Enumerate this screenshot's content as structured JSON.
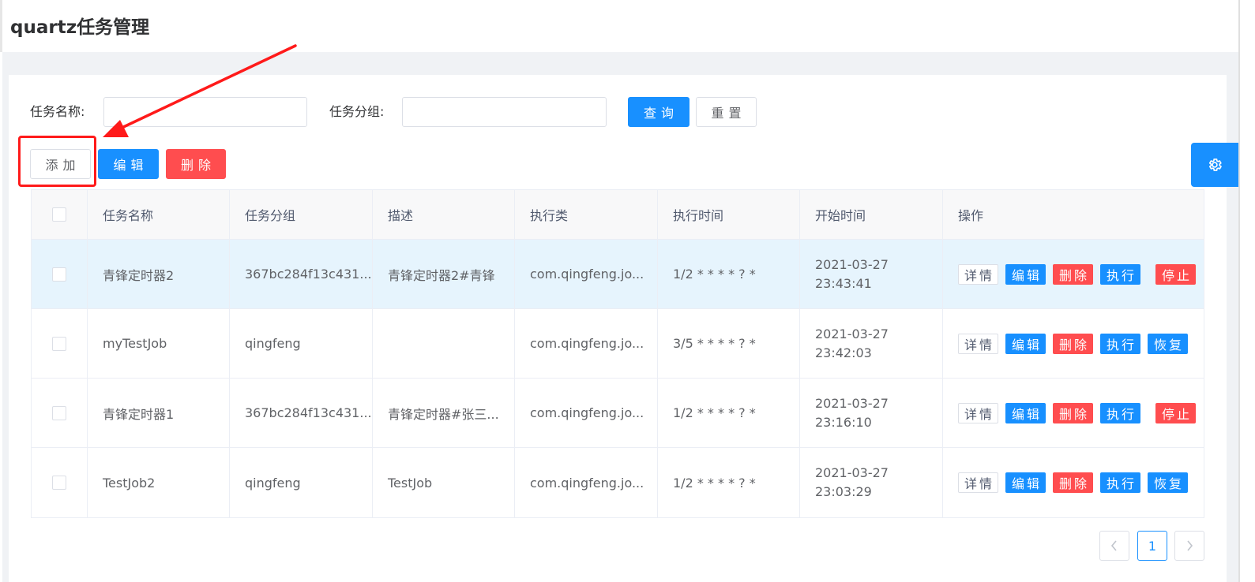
{
  "page_title": "quartz任务管理",
  "search": {
    "name_label": "任务名称:",
    "group_label": "任务分组:",
    "name_value": "",
    "group_value": "",
    "query_label": "查询",
    "reset_label": "重置"
  },
  "toolbar": {
    "add_label": "添加",
    "edit_label": "编辑",
    "delete_label": "删除"
  },
  "table": {
    "columns": [
      "任务名称",
      "任务分组",
      "描述",
      "执行类",
      "执行时间",
      "开始时间",
      "操作"
    ],
    "rows": [
      {
        "name": "青锋定时器2",
        "group": "367bc284f13c431...",
        "desc": "青锋定时器2#青锋",
        "cls": "com.qingfeng.jo...",
        "cron": "1/2 * * * * ? *",
        "date": "2021-03-27",
        "time": "23:43:41",
        "toggle": "停止"
      },
      {
        "name": "myTestJob",
        "group": "qingfeng",
        "desc": "",
        "cls": "com.qingfeng.jo...",
        "cron": "3/5 * * * * ? *",
        "date": "2021-03-27",
        "time": "23:42:03",
        "toggle": "恢复"
      },
      {
        "name": "青锋定时器1",
        "group": "367bc284f13c431...",
        "desc": "青锋定时器#张三...",
        "cls": "com.qingfeng.jo...",
        "cron": "1/2 * * * * ? *",
        "date": "2021-03-27",
        "time": "23:16:10",
        "toggle": "停止"
      },
      {
        "name": "TestJob2",
        "group": "qingfeng",
        "desc": "TestJob",
        "cls": "com.qingfeng.jo...",
        "cron": "1/2 * * * * ? *",
        "date": "2021-03-27",
        "time": "23:03:29",
        "toggle": "恢复"
      }
    ],
    "ops": {
      "detail": "详情",
      "edit": "编辑",
      "delete": "删除",
      "run": "执行"
    }
  },
  "pagination": {
    "current": "1",
    "prev_icon": "chevron-left-icon",
    "next_icon": "chevron-right-icon"
  },
  "icons": {
    "settings": "gear-icon"
  },
  "colors": {
    "primary": "#1890ff",
    "danger": "#ff4d4f",
    "annotation": "#ff1a1a",
    "row_highlight": "#e6f4fd"
  }
}
